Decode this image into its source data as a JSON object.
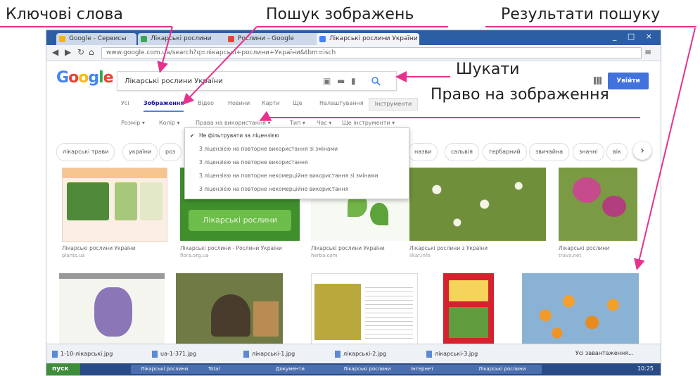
{
  "annotations": {
    "keywords": "Ключові слова",
    "image_search": "Пошук зображень",
    "results": "Результати пошуку",
    "search_button": "Шукати",
    "usage_rights": "Право на зображення"
  },
  "browser": {
    "tabs": [
      "Google - Сервисы",
      "Лікарські рослини",
      "Рослини - Google",
      "Лікарські рослини України"
    ],
    "address": "www.google.com.ua/search?q=лікарські+рослини+України&tbm=isch",
    "window_controls": "_ □ ×"
  },
  "google": {
    "logo": "Google",
    "logo_colors": [
      "#4285f4",
      "#ea4335",
      "#fbbc05",
      "#4285f4",
      "#34a853",
      "#ea4335"
    ],
    "query": "Лікарські рослини України",
    "signin": "Увійти",
    "nav_tabs": [
      "Усі",
      "Зображення",
      "Відео",
      "Новини",
      "Карти",
      "Ще",
      "Налаштування"
    ],
    "tools_button": "Інструменти",
    "tools": [
      "Розмір ▾",
      "Колір ▾",
      "Права на використання ▾",
      "Тип ▾",
      "Час ▾",
      "Ще інструменти ▾"
    ],
    "chips": [
      "лікарські трави",
      "україни",
      "роз",
      "назви",
      "сальвія",
      "гербарний",
      "звичайна",
      "значні",
      "вік"
    ],
    "rights_menu": [
      "Не фільтрувати за ліцензією",
      "З ліцензією на повторне використання зі змінами",
      "З ліцензією на повторне використання",
      "З ліцензією на повторне некомерційне використання зі змінами",
      "З ліцензією на повторне некомерційне використання"
    ],
    "results_row1": [
      {
        "caption": "Лікарські рослини України",
        "source": "plants.ua"
      },
      {
        "caption": "Лікарські рослини - Рослини України",
        "source": "flora.org.ua"
      },
      {
        "caption": "Лікарські рослини України",
        "source": "herba.com"
      },
      {
        "caption": "Лікарські рослини з України",
        "source": "likar.info"
      },
      {
        "caption": "Лікарські рослини",
        "source": "trava.net"
      }
    ],
    "thumb_label": "Лікарські рослини"
  },
  "downloads": {
    "items": [
      "1-10-лікарські.jpg",
      "ua-1-371.jpg",
      "лікарські-1.jpg",
      "лікарські-2.jpg",
      "лікарські-3.jpg"
    ],
    "show_all": "Усі завантаження..."
  },
  "taskbar": {
    "start": "пуск",
    "items": [
      "Лікарські рослини",
      "Total",
      "Документи",
      "Лікарські рослини",
      "Інтернет",
      "Лікарські рослини"
    ],
    "clock": "10:25"
  }
}
